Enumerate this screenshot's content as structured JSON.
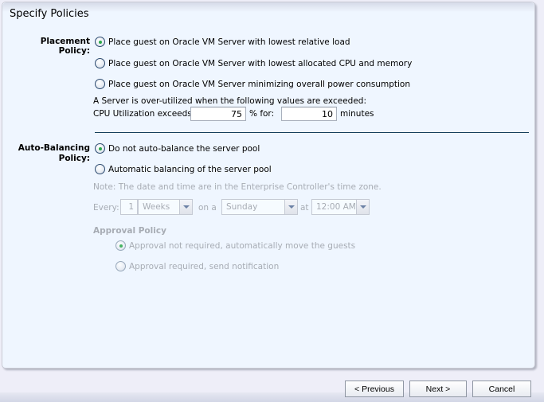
{
  "panel": {
    "title": "Specify Policies"
  },
  "placement": {
    "label": "Placement Policy:",
    "options": [
      {
        "label": "Place guest on Oracle VM Server with lowest relative load",
        "checked": true
      },
      {
        "label": "Place guest on Oracle VM Server with lowest allocated CPU and memory",
        "checked": false
      },
      {
        "label": "Place guest on Oracle VM Server minimizing overall power consumption",
        "checked": false
      }
    ],
    "threshold_note": "A Server is over-utilized when the following values are exceeded:",
    "cpu_label": "CPU Utilization exceeds:",
    "cpu_value": "75",
    "percent_for_label": "% for:",
    "minutes_value": "10",
    "minutes_label": "minutes"
  },
  "auto_balancing": {
    "label_line1": "Auto-Balancing",
    "label_line2": "Policy:",
    "options": [
      {
        "label": "Do not auto-balance the server pool",
        "checked": true
      },
      {
        "label": "Automatic balancing of the server pool",
        "checked": false
      }
    ],
    "note": "Note: The date and time are in the Enterprise Controller's time zone.",
    "schedule": {
      "every_label": "Every:",
      "every_value": "1",
      "unit_value": "Weeks",
      "on_label": "on a",
      "day_value": "Sunday",
      "at_label": "at",
      "time_value": "12:00 AM"
    },
    "approval": {
      "heading": "Approval Policy",
      "options": [
        {
          "label": "Approval not required, automatically move the guests",
          "checked": true
        },
        {
          "label": "Approval required, send notification",
          "checked": false
        }
      ]
    }
  },
  "buttons": {
    "previous": "< Previous",
    "next": "Next >",
    "cancel": "Cancel"
  }
}
